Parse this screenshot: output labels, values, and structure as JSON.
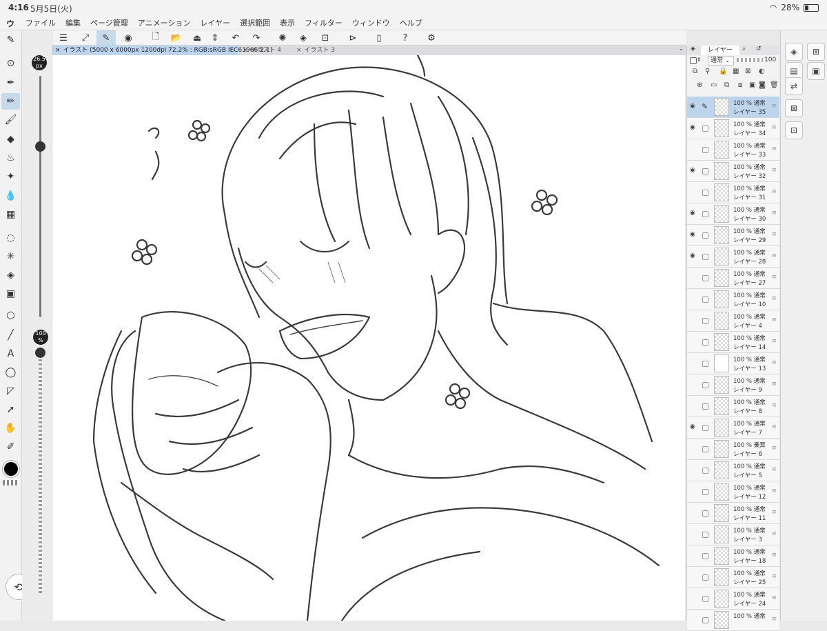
{
  "status": {
    "time": "4:16",
    "date": "5月5日(火)",
    "battery": "28%",
    "battery_level": 0.28
  },
  "menu": [
    "ファイル",
    "編集",
    "ページ管理",
    "アニメーション",
    "レイヤー",
    "選択範囲",
    "表示",
    "フィルター",
    "ウィンドウ",
    "ヘルプ"
  ],
  "brush": {
    "size_label": "26.5",
    "size_unit": "px",
    "size_level": 0.4,
    "opacity_label": "100",
    "opacity_unit": "%",
    "opacity_level": 1.0
  },
  "tabs": [
    {
      "label": "イラスト (5000 x 6000px 1200dpi 72.2% : RGB:sRGB IEC61966-2.1)",
      "active": true
    },
    {
      "label": "イラスト 4",
      "active": false
    },
    {
      "label": "イラスト 3",
      "active": false
    }
  ],
  "layer_panel": {
    "tab_label": "レイヤー",
    "blend_mode": "通常",
    "opacity_value": "100",
    "layers": [
      {
        "opacity": "100 %",
        "mode": "通常",
        "name": "レイヤー 35",
        "visible": true,
        "selected": true
      },
      {
        "opacity": "100 %",
        "mode": "通常",
        "name": "レイヤー 34",
        "visible": true
      },
      {
        "opacity": "100 %",
        "mode": "通常",
        "name": "レイヤー 33",
        "visible": false
      },
      {
        "opacity": "100 %",
        "mode": "通常",
        "name": "レイヤー 32",
        "visible": true
      },
      {
        "opacity": "100 %",
        "mode": "通常",
        "name": "レイヤー 31",
        "visible": false
      },
      {
        "opacity": "100 %",
        "mode": "通常",
        "name": "レイヤー 30",
        "visible": true
      },
      {
        "opacity": "100 %",
        "mode": "通常",
        "name": "レイヤー 29",
        "visible": true
      },
      {
        "opacity": "100 %",
        "mode": "通常",
        "name": "レイヤー 28",
        "visible": true
      },
      {
        "opacity": "100 %",
        "mode": "通常",
        "name": "レイヤー 27",
        "visible": false
      },
      {
        "opacity": "100 %",
        "mode": "通常",
        "name": "レイヤー 10",
        "visible": false
      },
      {
        "opacity": "100 %",
        "mode": "通常",
        "name": "レイヤー 4",
        "visible": false
      },
      {
        "opacity": "100 %",
        "mode": "通常",
        "name": "レイヤー 14",
        "visible": false
      },
      {
        "opacity": "100 %",
        "mode": "通常",
        "name": "レイヤー 13",
        "visible": false,
        "white": true
      },
      {
        "opacity": "100 %",
        "mode": "通常",
        "name": "レイヤー 9",
        "visible": false
      },
      {
        "opacity": "100 %",
        "mode": "通常",
        "name": "レイヤー 8",
        "visible": false
      },
      {
        "opacity": "100 %",
        "mode": "通常",
        "name": "レイヤー 7",
        "visible": true
      },
      {
        "opacity": "100 %",
        "mode": "乗算",
        "name": "レイヤー 6",
        "visible": false
      },
      {
        "opacity": "100 %",
        "mode": "通常",
        "name": "レイヤー 5",
        "visible": false
      },
      {
        "opacity": "100 %",
        "mode": "通常",
        "name": "レイヤー 12",
        "visible": false
      },
      {
        "opacity": "100 %",
        "mode": "通常",
        "name": "レイヤー 11",
        "visible": false
      },
      {
        "opacity": "100 %",
        "mode": "通常",
        "name": "レイヤー 3",
        "visible": false
      },
      {
        "opacity": "100 %",
        "mode": "通常",
        "name": "レイヤー 18",
        "visible": false
      },
      {
        "opacity": "100 %",
        "mode": "通常",
        "name": "レイヤー 25",
        "visible": false
      },
      {
        "opacity": "100 %",
        "mode": "通常",
        "name": "レイヤー 24",
        "visible": false
      },
      {
        "opacity": "100 %",
        "mode": "通常",
        "name": "",
        "visible": false
      }
    ]
  },
  "colors": {
    "accent": "#bcd4ec",
    "main_color": "#000000"
  }
}
